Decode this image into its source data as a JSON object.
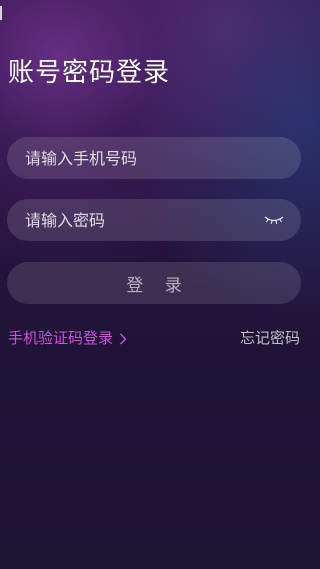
{
  "page": {
    "title": "账号密码登录"
  },
  "form": {
    "phone_placeholder": "请输入手机号码",
    "password_placeholder": "请输入密码",
    "password_toggle_icon": "eye-closed-icon",
    "login_label": "登 录"
  },
  "links": {
    "sms_login": "手机验证码登录",
    "sms_login_icon": "chevron-right-icon",
    "forgot_password": "忘记密码"
  },
  "colors": {
    "accent": "#d34fd9",
    "background": "#1d1233"
  }
}
